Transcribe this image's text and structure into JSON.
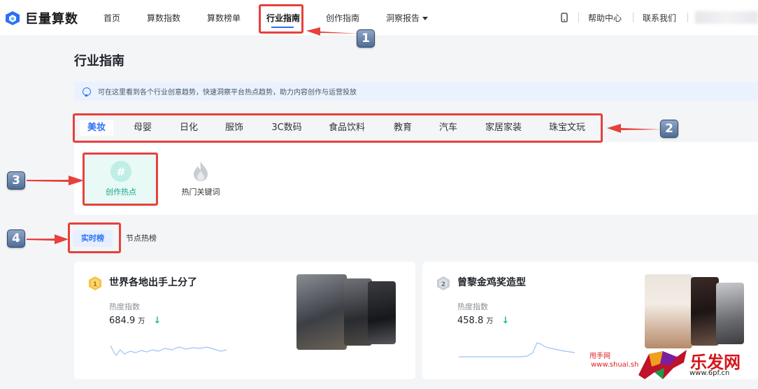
{
  "app": {
    "logo_text": "巨量算数"
  },
  "nav": {
    "items": [
      "首页",
      "算数指数",
      "算数榜单",
      "行业指南",
      "创作指南",
      "洞察报告"
    ],
    "active": "行业指南",
    "right": [
      "帮助中心",
      "联系我们"
    ]
  },
  "page": {
    "title": "行业指南",
    "tip": "可在这里看到各个行业创意趋势，快速洞察平台热点趋势，助力内容创作与运营投放"
  },
  "industry_tabs": [
    "美妆",
    "母婴",
    "日化",
    "服饰",
    "3C数码",
    "食品饮料",
    "教育",
    "汽车",
    "家居家装",
    "珠宝文玩"
  ],
  "feature_tiles": [
    {
      "label": "创作热点",
      "icon": "hashtag-search-icon"
    },
    {
      "label": "热门关键词",
      "icon": "flame-icon"
    }
  ],
  "rank_tabs": [
    "实时榜",
    "节点热榜"
  ],
  "hot_cards": [
    {
      "rank": "1",
      "title": "世界各地出手上分了",
      "metric_label": "热度指数",
      "value": "684.9",
      "unit": "万",
      "trend": "down"
    },
    {
      "rank": "2",
      "title": "曾黎金鸡奖造型",
      "metric_label": "热度指数",
      "value": "458.8",
      "unit": "万",
      "trend": "down"
    }
  ],
  "annotations": [
    "1",
    "2",
    "3",
    "4"
  ],
  "watermark": {
    "line1": "甩手网",
    "line2": "www.shuai.sh",
    "brand": "乐发网",
    "url": "www.6pf.cn"
  },
  "colors": {
    "accent": "#2d6ff7",
    "highlight": "#e6413c",
    "teal": "#18a58e",
    "down": "#1bbf8a"
  }
}
